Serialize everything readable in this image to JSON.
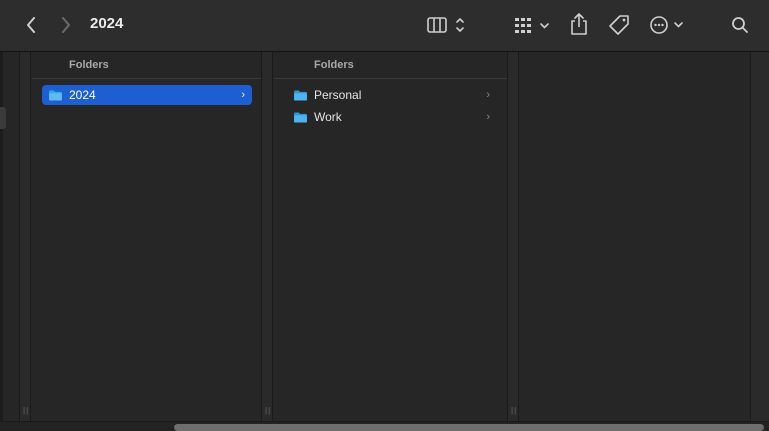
{
  "window": {
    "title": "2024"
  },
  "toolbar": {
    "back_icon": "chevron-left-icon",
    "forward_icon": "chevron-right-icon",
    "view_icon": "column-view-icon",
    "group_icon": "grid-group-icon",
    "share_icon": "share-icon",
    "tag_icon": "tag-icon",
    "more_icon": "ellipsis-circle-icon",
    "search_icon": "search-icon"
  },
  "columns": [
    {
      "header": "Folders",
      "items": [
        {
          "label": "2024",
          "selected": true
        }
      ]
    },
    {
      "header": "Folders",
      "items": [
        {
          "label": "Personal",
          "selected": false
        },
        {
          "label": "Work",
          "selected": false
        }
      ]
    }
  ],
  "colors": {
    "selection": "#1d5fd2",
    "folder": "#3aa6e6",
    "background": "#262626"
  }
}
